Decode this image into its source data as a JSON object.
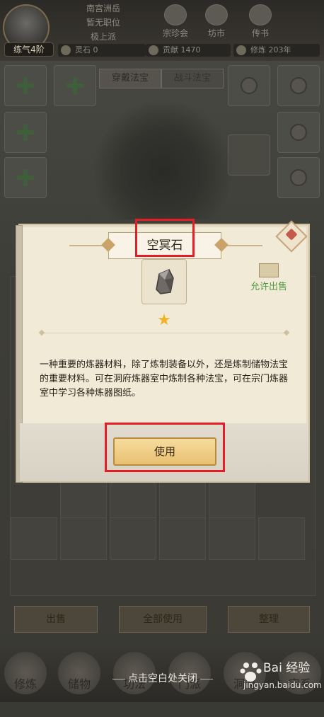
{
  "topbar": {
    "player_lines": [
      "南宫洲岳",
      "暂无职位",
      "极上派"
    ],
    "realm": "练气4阶",
    "icons": [
      {
        "label": "宗珍会",
        "name": "treasure-pavilion-icon"
      },
      {
        "label": "坊市",
        "name": "market-icon"
      },
      {
        "label": "传书",
        "name": "mail-icon"
      }
    ],
    "stats": [
      {
        "label": "灵石",
        "value": "0"
      },
      {
        "label": "贡献",
        "value": "1470"
      },
      {
        "label": "修炼",
        "value": "203年"
      }
    ]
  },
  "equip_tabs": [
    "穿戴法宝",
    "战斗法宝"
  ],
  "bottom_buttons": [
    "出售",
    "全部使用",
    "整理"
  ],
  "nav_items": [
    "修炼",
    "储物",
    "功法",
    "门派",
    "洞府",
    "宗系"
  ],
  "close_hint": "点击空白处关闭",
  "watermark": {
    "cn": "Bai 经验",
    "en": "jingyan.baidu.com"
  },
  "modal": {
    "title": "空冥石",
    "sellable_label": "允许出售",
    "stars": "★",
    "description": "一种重要的炼器材料，除了炼制装备以外，还是炼制储物法宝的重要材料。可在洞府炼器室中炼制各种法宝，可在宗门炼器室中学习各种炼器图纸。",
    "use_button": "使用"
  },
  "colors": {
    "highlight": "#e51d26",
    "sell_green": "#4f9a3f",
    "star_gold": "#f1b22a"
  }
}
